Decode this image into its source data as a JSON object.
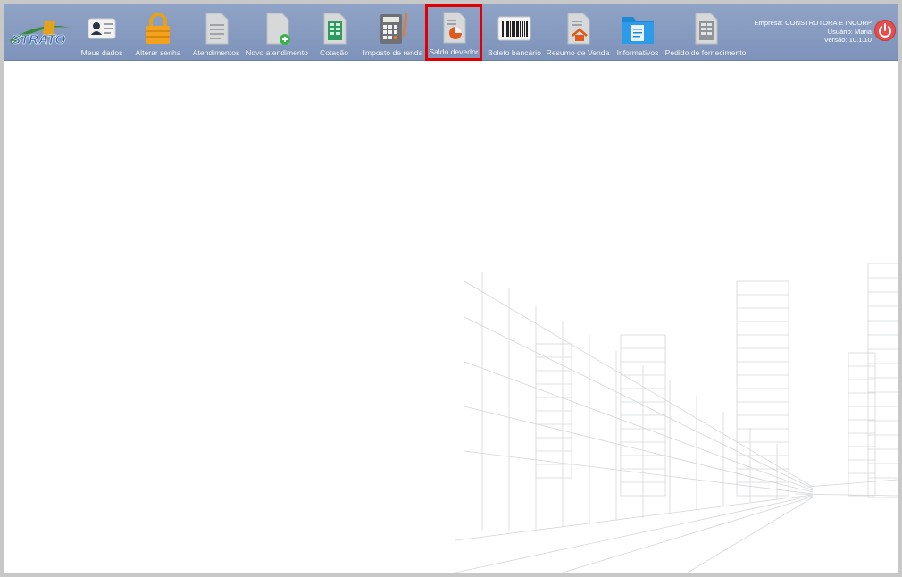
{
  "app": {
    "logo_text": "STRATO"
  },
  "toolbar": {
    "items": [
      {
        "label": "Meus dados",
        "icon": "id-card-icon"
      },
      {
        "label": "Alterar senha",
        "icon": "padlock-icon"
      },
      {
        "label": "Atendimentos",
        "icon": "document-icon"
      },
      {
        "label": "Novo atendimento",
        "icon": "new-document-icon"
      },
      {
        "label": "Cotação",
        "icon": "spreadsheet-icon"
      },
      {
        "label": "Imposto de renda",
        "icon": "calculator-icon"
      },
      {
        "label": "Saldo devedor",
        "icon": "pie-chart-document-icon",
        "selected": true
      },
      {
        "label": "Boleto bancário",
        "icon": "barcode-icon"
      },
      {
        "label": "Resumo de Venda",
        "icon": "house-document-icon"
      },
      {
        "label": "Informativos",
        "icon": "folder-icon"
      },
      {
        "label": "Pedido de fornecimento",
        "icon": "table-document-icon"
      }
    ]
  },
  "session": {
    "company": "Empresa: CONSTRUTORA E INCORP",
    "user": "Usuário: Maria",
    "version": "Versão: 10.1.10"
  },
  "colors": {
    "toolbar": "#8fa3c6",
    "highlight": "#e00000",
    "power": "#e84d4d"
  }
}
